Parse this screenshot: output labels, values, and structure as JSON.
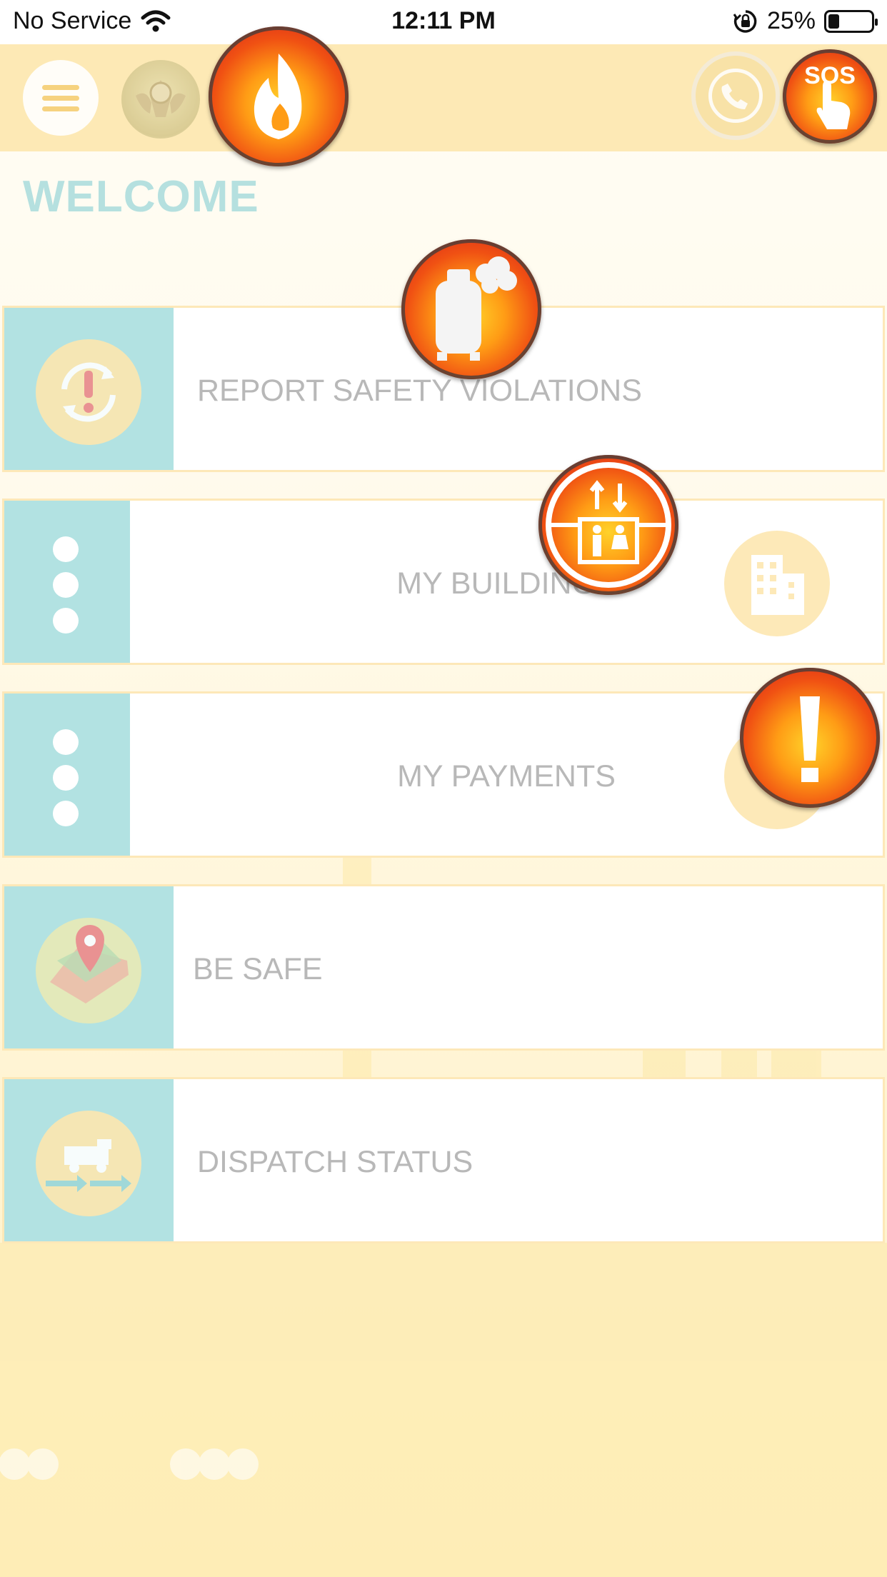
{
  "status_bar": {
    "carrier": "No Service",
    "time": "12:11 PM",
    "battery_percent": "25%",
    "battery_level": 0.25,
    "wifi_icon": "wifi-icon",
    "rotation_lock_icon": "rotation-lock-icon"
  },
  "header": {
    "menu_icon": "hamburger-menu-icon",
    "emblem": "uae-emblem-logo",
    "phone_icon": "phone-icon",
    "sos_label": "SOS",
    "background_color": "#fde9b5"
  },
  "floating_buttons": [
    {
      "name": "fire-icon"
    },
    {
      "name": "gas-cylinder-icon"
    },
    {
      "name": "elevator-icon"
    },
    {
      "name": "exclamation-icon"
    },
    {
      "name": "sos-hand-icon"
    }
  ],
  "welcome_text": "WELCOME",
  "menu": [
    {
      "label": "REPORT SAFETY VIOLATIONS",
      "icon": "safety-violation-icon"
    },
    {
      "label": "MY BUILDINGS",
      "icon": "building-icon"
    },
    {
      "label": "MY PAYMENTS",
      "icon": "payment-icon"
    },
    {
      "label": "BE SAFE",
      "icon": "map-pin-icon"
    },
    {
      "label": "DISPATCH STATUS",
      "icon": "fire-truck-icon"
    }
  ],
  "colors": {
    "accent_teal": "#b2e2e2",
    "accent_yellow": "#fde9b5",
    "alert_red": "#d21c1c",
    "alert_orange": "#ff9c15"
  }
}
